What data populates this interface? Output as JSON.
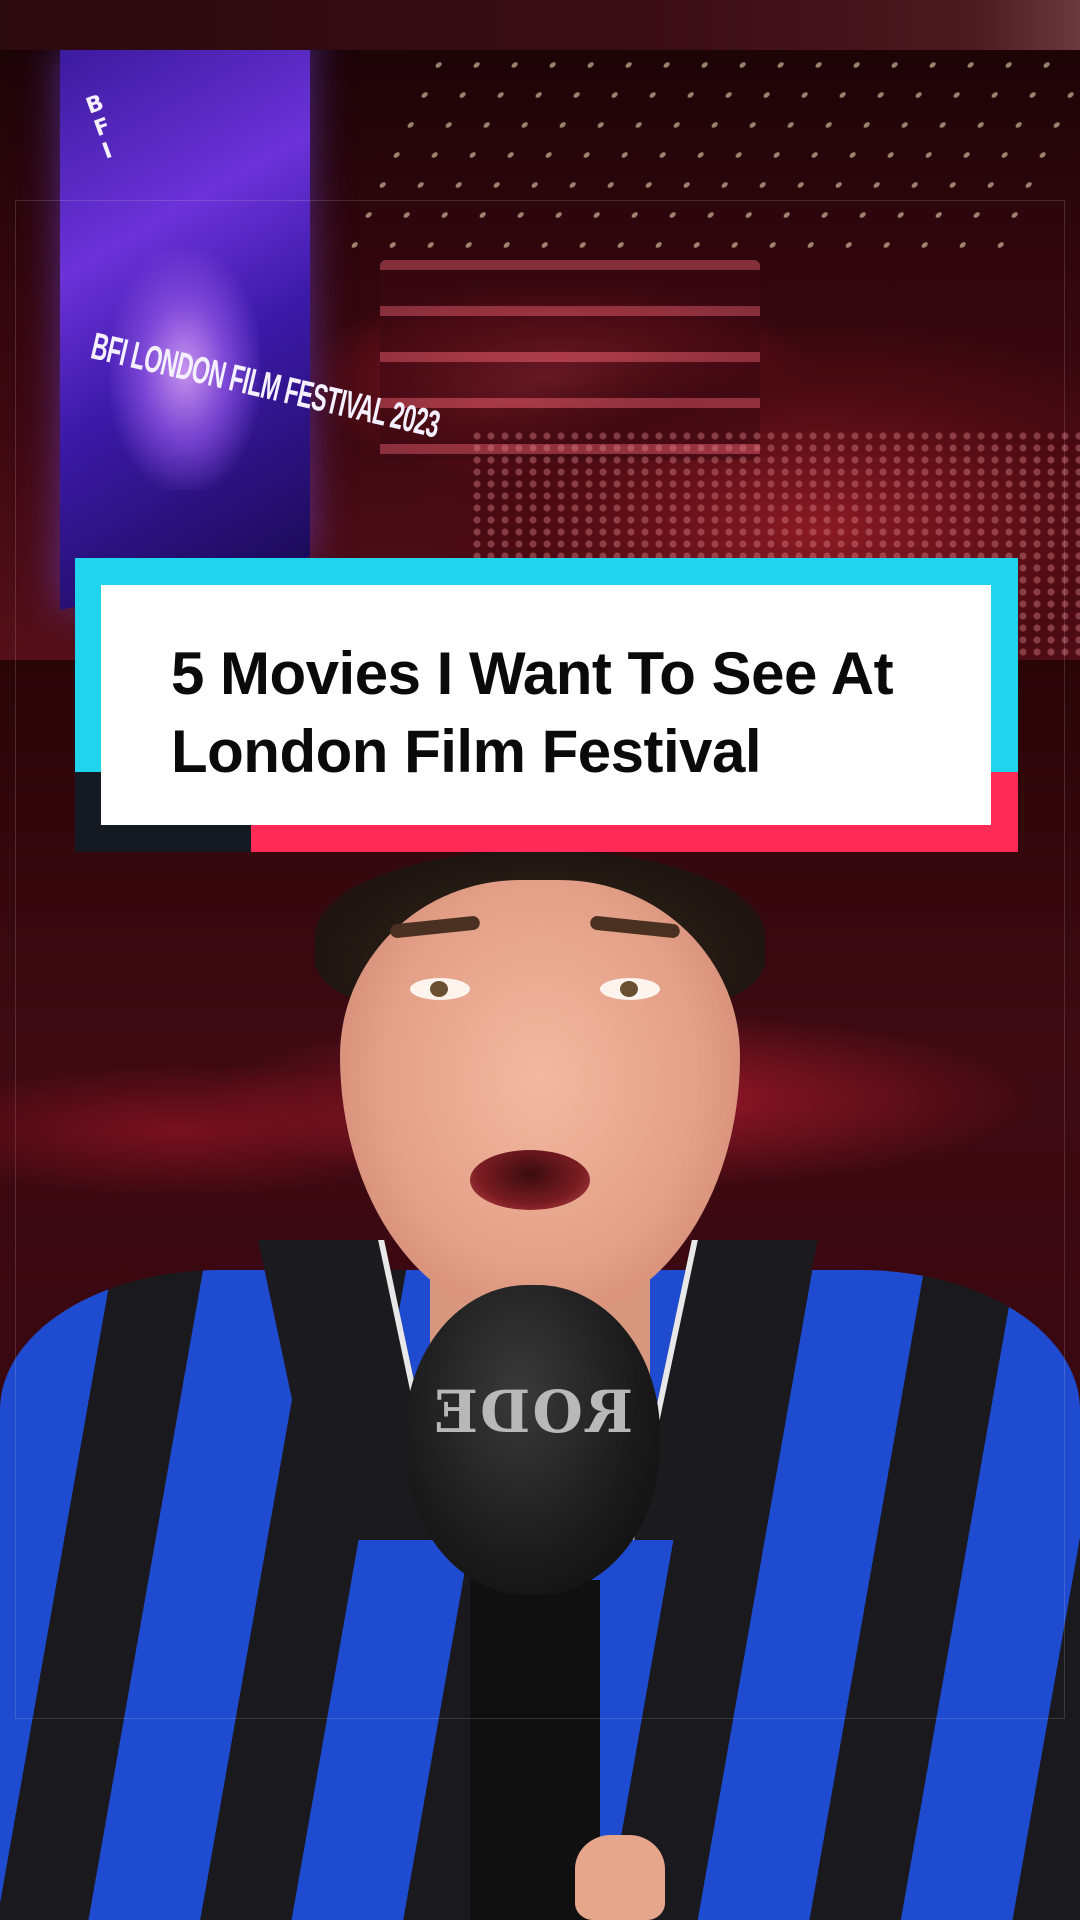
{
  "video": {
    "title_card": {
      "text": "5 Movies I Want To See At London Film Festival",
      "colors": {
        "accent_cyan": "#20d4ee",
        "accent_red": "#ff2a55",
        "accent_dark": "#151922",
        "card_background": "#ffffff"
      }
    },
    "background_photo": {
      "screen_logo": "B\nF\nI",
      "screen_text": "BFI LONDON FILM FESTIVAL 2023"
    },
    "microphone": {
      "brand": "RODE"
    }
  }
}
